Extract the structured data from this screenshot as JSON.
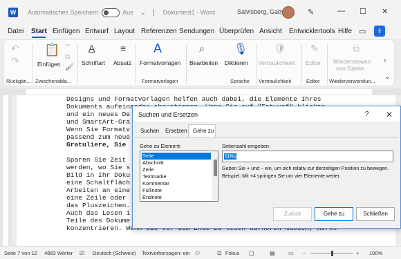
{
  "titlebar": {
    "app_icon": "W",
    "autosave_label": "Automatisches Speichern",
    "toggle_label": "Aus",
    "doc_title": "Dokument1 - Word",
    "user_name": "Salvisberg, Gaby",
    "minimize": "—",
    "maximize": "☐",
    "close": "✕"
  },
  "menu": {
    "items": [
      "Datei",
      "Start",
      "Einfügen",
      "Entwurf",
      "Layout",
      "Referenzen",
      "Sendungen",
      "Überprüfen",
      "Ansicht",
      "Entwicklertools",
      "Hilfe"
    ],
    "active": "Start"
  },
  "ribbon": {
    "einfuegen": "Einfügen",
    "schriftart": "Schriftart",
    "absatz": "Absatz",
    "formatvorlagen": "Formatvorlagen",
    "bearbeiten": "Bearbeiten",
    "diktieren": "Diktieren",
    "vertraulichkeit": "Vertraulichkeit",
    "editor": "Editor",
    "wiederverwenden_1": "Wiederverwen",
    "wiederverwenden_2": "von Dateie",
    "groups": {
      "rueckgaengig": "Rückgän...",
      "zwischenablage": "Zwischenabla...",
      "formatvorlagen": "Formatvorlagen",
      "sprache": "Sprache",
      "vertraulichkeit": "Vertraulichkeit",
      "editor": "Editor",
      "wiederverwendung": "Wiederverwendun..."
    }
  },
  "document": {
    "lines": [
      {
        "text": "Designs und Formatvorlagen helfen auch dabei, die Elemente Ihres",
        "bold": false
      },
      {
        "text": "Dokuments aufeinander abzustimmen. Wenn Sie auf \"Entwurf\" klicken",
        "bold": false
      },
      {
        "text": "und ein neues De",
        "bold": false
      },
      {
        "text": "und SmartArt-Gra",
        "bold": false
      },
      {
        "text": "Wenn Sie Formatv",
        "bold": false
      },
      {
        "text": "passend zum neue",
        "bold": false
      },
      {
        "text": "Gratuliere, Sie",
        "bold": true
      },
      {
        "text": "",
        "bold": false
      },
      {
        "text": "Sparen Sie Zeit",
        "bold": false
      },
      {
        "text": "werden, wo Sie s",
        "bold": false
      },
      {
        "text": "Bild in Ihr Doku",
        "bold": false
      },
      {
        "text": "eine Schaltfläch",
        "bold": false
      },
      {
        "text": "Arbeiten an eine",
        "bold": false
      },
      {
        "text": "eine Zeile oder",
        "bold": false
      },
      {
        "text": "das Pluszeichen.",
        "bold": false
      },
      {
        "text": "Auch das Lesen i",
        "bold": false
      },
      {
        "text": "Teile des Dokume",
        "bold": false
      },
      {
        "text": "konzentrieren. Wenn Sie vor dem Ende zu lesen aufhören müssen, merkt",
        "bold": false
      }
    ]
  },
  "dialog": {
    "title": "Suchen und Ersetzen",
    "help": "?",
    "close": "✕",
    "tabs": [
      "Suchen",
      "Ersetzen",
      "Gehe zu"
    ],
    "active_tab": "Gehe zu",
    "goto_label": "Gehe zu Element:",
    "elements": [
      "Seite",
      "Abschnitt",
      "Zeile",
      "Textmarke",
      "Kommentar",
      "Fußnote",
      "Endnote"
    ],
    "selected_element": "Seite",
    "page_label": "Seitenzahl eingeben:",
    "page_value": "50%",
    "hint": "Geben Sie + und – ein, um sich relativ zur derzeitigen Position zu bewegen. Beispiel: Mit +4 springen Sie um vier Elemente weiter.",
    "buttons": {
      "back": "Zurück",
      "goto": "Gehe zu",
      "close": "Schließen"
    }
  },
  "status": {
    "page": "Seite 7 von 12",
    "words": "4883 Wörter",
    "language": "Deutsch (Schweiz)",
    "predictions": "Textvorhersagen: ein",
    "focus": "Fokus",
    "zoom": "100%"
  },
  "colors": {
    "accent": "#185abd",
    "selection": "#0078d7"
  }
}
